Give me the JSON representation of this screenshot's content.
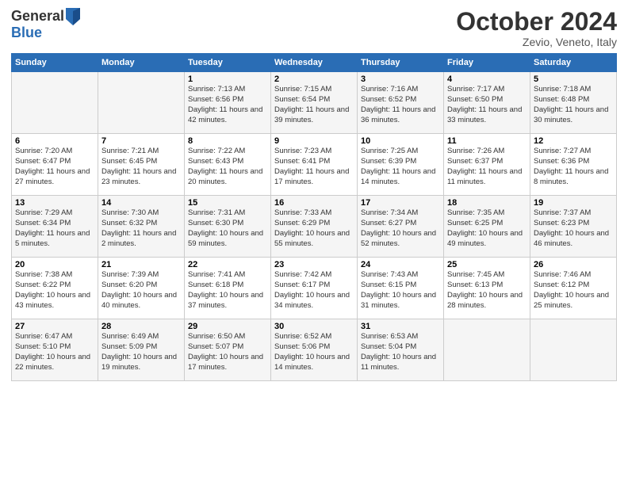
{
  "header": {
    "logo_general": "General",
    "logo_blue": "Blue",
    "month_title": "October 2024",
    "subtitle": "Zevio, Veneto, Italy"
  },
  "days_of_week": [
    "Sunday",
    "Monday",
    "Tuesday",
    "Wednesday",
    "Thursday",
    "Friday",
    "Saturday"
  ],
  "weeks": [
    [
      {
        "day": "",
        "sunrise": "",
        "sunset": "",
        "daylight": ""
      },
      {
        "day": "",
        "sunrise": "",
        "sunset": "",
        "daylight": ""
      },
      {
        "day": "1",
        "sunrise": "Sunrise: 7:13 AM",
        "sunset": "Sunset: 6:56 PM",
        "daylight": "Daylight: 11 hours and 42 minutes."
      },
      {
        "day": "2",
        "sunrise": "Sunrise: 7:15 AM",
        "sunset": "Sunset: 6:54 PM",
        "daylight": "Daylight: 11 hours and 39 minutes."
      },
      {
        "day": "3",
        "sunrise": "Sunrise: 7:16 AM",
        "sunset": "Sunset: 6:52 PM",
        "daylight": "Daylight: 11 hours and 36 minutes."
      },
      {
        "day": "4",
        "sunrise": "Sunrise: 7:17 AM",
        "sunset": "Sunset: 6:50 PM",
        "daylight": "Daylight: 11 hours and 33 minutes."
      },
      {
        "day": "5",
        "sunrise": "Sunrise: 7:18 AM",
        "sunset": "Sunset: 6:48 PM",
        "daylight": "Daylight: 11 hours and 30 minutes."
      }
    ],
    [
      {
        "day": "6",
        "sunrise": "Sunrise: 7:20 AM",
        "sunset": "Sunset: 6:47 PM",
        "daylight": "Daylight: 11 hours and 27 minutes."
      },
      {
        "day": "7",
        "sunrise": "Sunrise: 7:21 AM",
        "sunset": "Sunset: 6:45 PM",
        "daylight": "Daylight: 11 hours and 23 minutes."
      },
      {
        "day": "8",
        "sunrise": "Sunrise: 7:22 AM",
        "sunset": "Sunset: 6:43 PM",
        "daylight": "Daylight: 11 hours and 20 minutes."
      },
      {
        "day": "9",
        "sunrise": "Sunrise: 7:23 AM",
        "sunset": "Sunset: 6:41 PM",
        "daylight": "Daylight: 11 hours and 17 minutes."
      },
      {
        "day": "10",
        "sunrise": "Sunrise: 7:25 AM",
        "sunset": "Sunset: 6:39 PM",
        "daylight": "Daylight: 11 hours and 14 minutes."
      },
      {
        "day": "11",
        "sunrise": "Sunrise: 7:26 AM",
        "sunset": "Sunset: 6:37 PM",
        "daylight": "Daylight: 11 hours and 11 minutes."
      },
      {
        "day": "12",
        "sunrise": "Sunrise: 7:27 AM",
        "sunset": "Sunset: 6:36 PM",
        "daylight": "Daylight: 11 hours and 8 minutes."
      }
    ],
    [
      {
        "day": "13",
        "sunrise": "Sunrise: 7:29 AM",
        "sunset": "Sunset: 6:34 PM",
        "daylight": "Daylight: 11 hours and 5 minutes."
      },
      {
        "day": "14",
        "sunrise": "Sunrise: 7:30 AM",
        "sunset": "Sunset: 6:32 PM",
        "daylight": "Daylight: 11 hours and 2 minutes."
      },
      {
        "day": "15",
        "sunrise": "Sunrise: 7:31 AM",
        "sunset": "Sunset: 6:30 PM",
        "daylight": "Daylight: 10 hours and 59 minutes."
      },
      {
        "day": "16",
        "sunrise": "Sunrise: 7:33 AM",
        "sunset": "Sunset: 6:29 PM",
        "daylight": "Daylight: 10 hours and 55 minutes."
      },
      {
        "day": "17",
        "sunrise": "Sunrise: 7:34 AM",
        "sunset": "Sunset: 6:27 PM",
        "daylight": "Daylight: 10 hours and 52 minutes."
      },
      {
        "day": "18",
        "sunrise": "Sunrise: 7:35 AM",
        "sunset": "Sunset: 6:25 PM",
        "daylight": "Daylight: 10 hours and 49 minutes."
      },
      {
        "day": "19",
        "sunrise": "Sunrise: 7:37 AM",
        "sunset": "Sunset: 6:23 PM",
        "daylight": "Daylight: 10 hours and 46 minutes."
      }
    ],
    [
      {
        "day": "20",
        "sunrise": "Sunrise: 7:38 AM",
        "sunset": "Sunset: 6:22 PM",
        "daylight": "Daylight: 10 hours and 43 minutes."
      },
      {
        "day": "21",
        "sunrise": "Sunrise: 7:39 AM",
        "sunset": "Sunset: 6:20 PM",
        "daylight": "Daylight: 10 hours and 40 minutes."
      },
      {
        "day": "22",
        "sunrise": "Sunrise: 7:41 AM",
        "sunset": "Sunset: 6:18 PM",
        "daylight": "Daylight: 10 hours and 37 minutes."
      },
      {
        "day": "23",
        "sunrise": "Sunrise: 7:42 AM",
        "sunset": "Sunset: 6:17 PM",
        "daylight": "Daylight: 10 hours and 34 minutes."
      },
      {
        "day": "24",
        "sunrise": "Sunrise: 7:43 AM",
        "sunset": "Sunset: 6:15 PM",
        "daylight": "Daylight: 10 hours and 31 minutes."
      },
      {
        "day": "25",
        "sunrise": "Sunrise: 7:45 AM",
        "sunset": "Sunset: 6:13 PM",
        "daylight": "Daylight: 10 hours and 28 minutes."
      },
      {
        "day": "26",
        "sunrise": "Sunrise: 7:46 AM",
        "sunset": "Sunset: 6:12 PM",
        "daylight": "Daylight: 10 hours and 25 minutes."
      }
    ],
    [
      {
        "day": "27",
        "sunrise": "Sunrise: 6:47 AM",
        "sunset": "Sunset: 5:10 PM",
        "daylight": "Daylight: 10 hours and 22 minutes."
      },
      {
        "day": "28",
        "sunrise": "Sunrise: 6:49 AM",
        "sunset": "Sunset: 5:09 PM",
        "daylight": "Daylight: 10 hours and 19 minutes."
      },
      {
        "day": "29",
        "sunrise": "Sunrise: 6:50 AM",
        "sunset": "Sunset: 5:07 PM",
        "daylight": "Daylight: 10 hours and 17 minutes."
      },
      {
        "day": "30",
        "sunrise": "Sunrise: 6:52 AM",
        "sunset": "Sunset: 5:06 PM",
        "daylight": "Daylight: 10 hours and 14 minutes."
      },
      {
        "day": "31",
        "sunrise": "Sunrise: 6:53 AM",
        "sunset": "Sunset: 5:04 PM",
        "daylight": "Daylight: 10 hours and 11 minutes."
      },
      {
        "day": "",
        "sunrise": "",
        "sunset": "",
        "daylight": ""
      },
      {
        "day": "",
        "sunrise": "",
        "sunset": "",
        "daylight": ""
      }
    ]
  ]
}
